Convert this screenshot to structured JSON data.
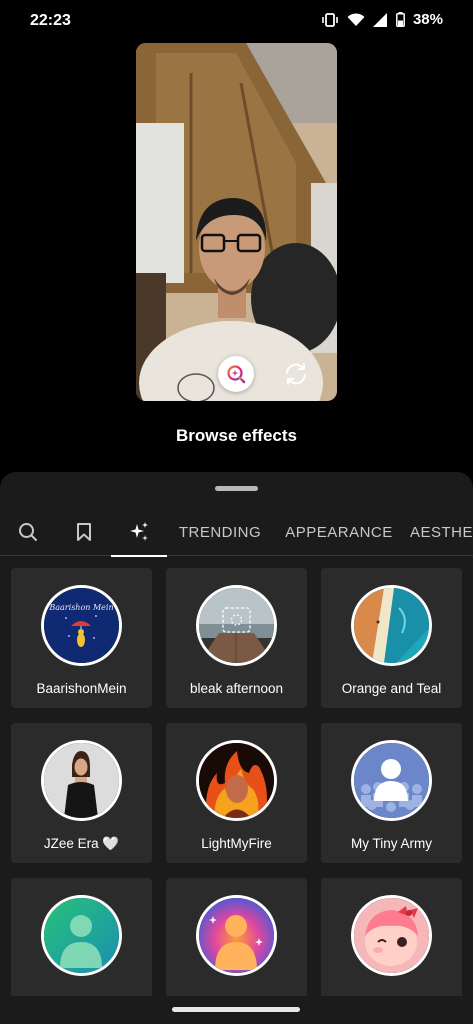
{
  "status": {
    "time": "22:23",
    "battery": "38%"
  },
  "browse_title": "Browse effects",
  "tabs": {
    "trending": "TRENDING",
    "appearance": "APPEARANCE",
    "aesthetic": "AESTHE"
  },
  "effects": [
    {
      "label": "BaarishonMein",
      "thumb_text": "Baarishon Mein"
    },
    {
      "label": "bleak afternoon"
    },
    {
      "label": "Orange and Teal"
    },
    {
      "label": "JZee Era 🤍"
    },
    {
      "label": "LightMyFire"
    },
    {
      "label": "My Tiny Army"
    },
    {
      "label": ""
    },
    {
      "label": ""
    },
    {
      "label": ""
    }
  ],
  "colors": {
    "background": "#000000",
    "sheet": "#1b1b1b",
    "card": "#2b2b2b",
    "accent": "#ffffff"
  }
}
